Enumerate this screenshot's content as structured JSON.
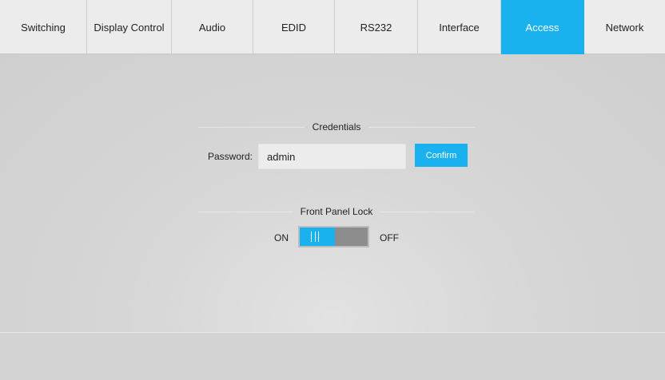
{
  "tabs": [
    {
      "label": "Switching",
      "active": false
    },
    {
      "label": "Display Control",
      "active": false
    },
    {
      "label": "Audio",
      "active": false
    },
    {
      "label": "EDID",
      "active": false
    },
    {
      "label": "RS232",
      "active": false
    },
    {
      "label": "Interface",
      "active": false
    },
    {
      "label": "Access",
      "active": true
    },
    {
      "label": "Network",
      "active": false
    }
  ],
  "credentials": {
    "heading": "Credentials",
    "password_label": "Password:",
    "password_value": "admin",
    "confirm_label": "Confirm"
  },
  "front_panel_lock": {
    "heading": "Front Panel Lock",
    "on_label": "ON",
    "off_label": "OFF",
    "state": "ON"
  },
  "colors": {
    "accent": "#19b2ee",
    "tab_background": "#ececec",
    "page_background": "#d6d6d6",
    "toggle_off": "#8c8c8c"
  }
}
